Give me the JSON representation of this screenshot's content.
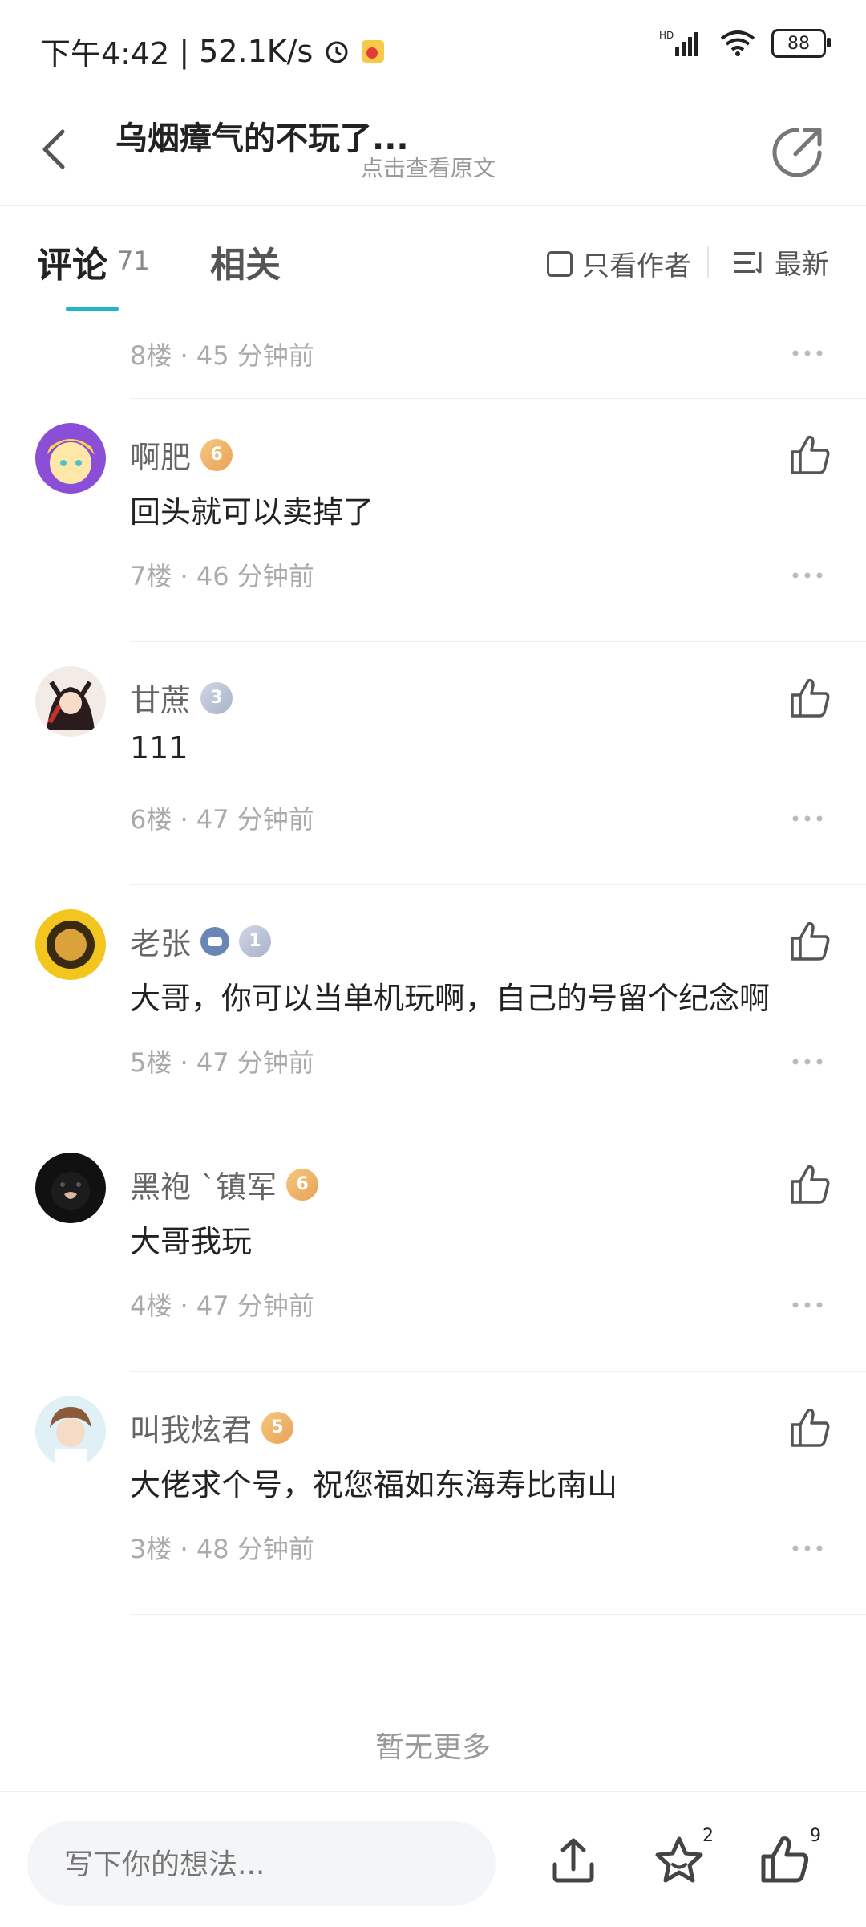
{
  "status_bar": {
    "time": "下午4:42",
    "net_speed": "52.1K/s",
    "battery": "88",
    "signal_label": "HD"
  },
  "nav": {
    "title": "乌烟瘴气的不玩了...",
    "subtitle": "点击查看原文"
  },
  "tabs": {
    "comment_label": "评论",
    "comment_count": "71",
    "related_label": "相关",
    "only_author": "只看作者",
    "sort_label": "最新"
  },
  "top_partial": {
    "meta": "8楼 · 45 分钟前"
  },
  "comments": [
    {
      "user": "啊肥",
      "badge": "6",
      "text": "回头就可以卖掉了",
      "meta": "7楼 · 46 分钟前"
    },
    {
      "user": "甘蔗",
      "badge": "3",
      "text": "111",
      "meta": "6楼 · 47 分钟前"
    },
    {
      "user": "老张",
      "badge": "1",
      "text": "大哥，你可以当单机玩啊，自己的号留个纪念啊",
      "meta": "5楼 · 47 分钟前"
    },
    {
      "user": "黑袍 `镇军",
      "badge": "6",
      "text": "大哥我玩",
      "meta": "4楼 · 47 分钟前"
    },
    {
      "user": "叫我炫君",
      "badge": "5",
      "text": "大佬求个号，祝您福如东海寿比南山",
      "meta": "3楼 · 48 分钟前"
    }
  ],
  "no_more": "暂无更多",
  "bottom": {
    "input_placeholder": "写下你的想法...",
    "star_count": "2",
    "like_count": "9"
  },
  "colors": {
    "accent": "#21b5c7",
    "gold_badge": "#e8a257",
    "silver_badge": "#a9b3c8"
  }
}
